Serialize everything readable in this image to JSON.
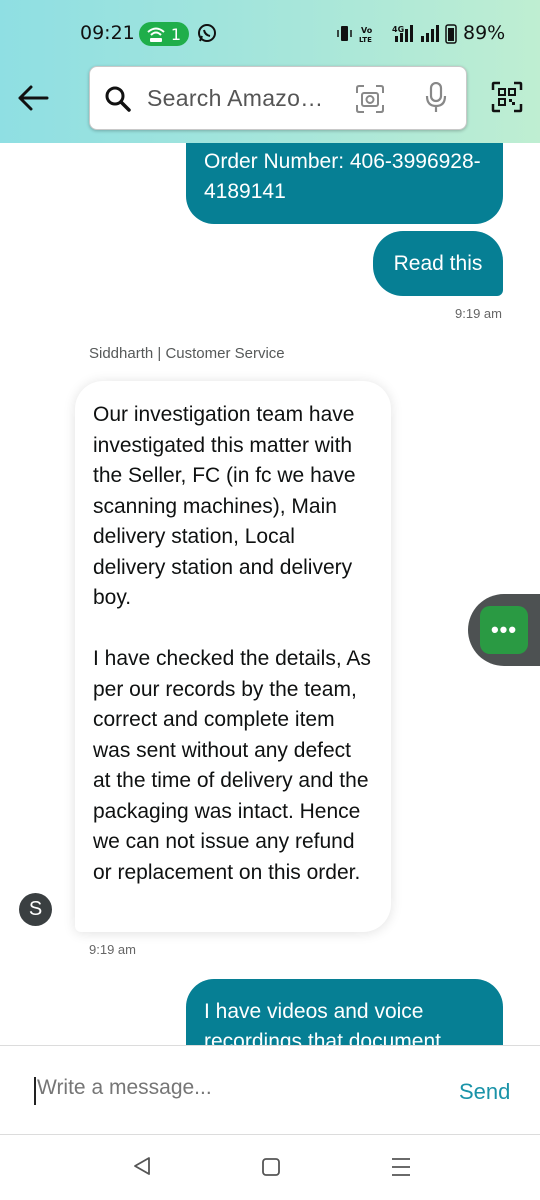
{
  "status_bar": {
    "time": "09:21",
    "hotspot_count": "1",
    "network_label": "4G",
    "battery": "89%"
  },
  "search": {
    "placeholder": "Search Amazo…"
  },
  "messages": {
    "order_number": "Order Number: 406-3996928-4189141",
    "read_this": "Read this",
    "sent_time": "9:19 am",
    "agent_name": "Siddharth | Customer Service",
    "agent_paragraph_1": "Our investigation team have investigated this matter with the Seller, FC (in fc we have scanning machines), Main delivery station, Local delivery station and delivery boy.",
    "agent_paragraph_2": "I have checked the details, As per our records by the team, correct and complete item was sent without any defect at the time of delivery and the packaging was intact. Hence we can not issue any refund or replacement on this order.",
    "agent_avatar": "S",
    "agent_time": "9:19 am",
    "partial_message": "I have videos and voice recordings that document"
  },
  "composer": {
    "placeholder": "Write a message...",
    "send_label": "Send"
  },
  "colors": {
    "outgoing_bubble": "#067f94",
    "send_accent": "#1a93a8",
    "header_gradient_start": "#8fdfe3",
    "float_button": "#2a9a43"
  }
}
